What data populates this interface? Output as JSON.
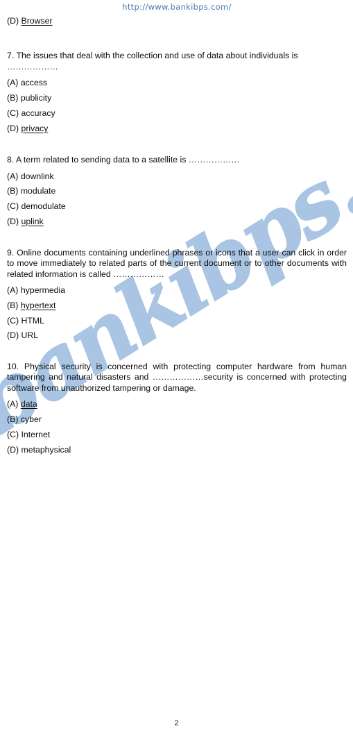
{
  "document": {
    "header_url": "http://www.bankibps.com/",
    "watermark_text": "bankibps.com",
    "page_number": "2",
    "watermark_color": "#a9c5e3",
    "header_color": "#4a7ab0",
    "text_color": "#0d0d0d"
  },
  "carryover_option": {
    "marker": "(D) ",
    "text": "Browser",
    "underlined": true
  },
  "questions": [
    {
      "number": "7",
      "stem": "7. The issues that deal with the collection and use of data about individuals is ………………",
      "justified": false,
      "options": [
        {
          "marker": "(A) ",
          "text": "access",
          "underlined": false
        },
        {
          "marker": "(B) ",
          "text": "publicity",
          "underlined": false
        },
        {
          "marker": "(C) ",
          "text": "accuracy",
          "underlined": false
        },
        {
          "marker": "(D) ",
          "text": "privacy",
          "underlined": true
        }
      ]
    },
    {
      "number": "8",
      "stem": "8. A term related to sending data to a satellite is ………………",
      "justified": false,
      "options": [
        {
          "marker": "(A) ",
          "text": "downlink",
          "underlined": false
        },
        {
          "marker": "(B) ",
          "text": "modulate",
          "underlined": false
        },
        {
          "marker": "(C) ",
          "text": "demodulate",
          "underlined": false
        },
        {
          "marker": "(D) ",
          "text": "uplink",
          "underlined": true
        }
      ]
    },
    {
      "number": "9",
      "stem": "9. Online documents containing underlined phrases or icons that a user can click in order to move immediately to related parts of the current document or to other documents with related information is called ………………",
      "justified": true,
      "options": [
        {
          "marker": "(A) ",
          "text": "hypermedia",
          "underlined": false
        },
        {
          "marker": "(B) ",
          "text": "hypertext",
          "underlined": true
        },
        {
          "marker": "(C) ",
          "text": "HTML",
          "underlined": false
        },
        {
          "marker": "(D) ",
          "text": "URL",
          "underlined": false
        }
      ]
    },
    {
      "number": "10",
      "stem": "10. Physical security is concerned with protecting computer hardware from human tampering and natural disasters and ………………security is concerned with protecting software from unauthorized tampering or damage.",
      "justified": true,
      "options": [
        {
          "marker": "(A) ",
          "text": "data",
          "underlined": true
        },
        {
          "marker": "(B) ",
          "text": "cyber",
          "underlined": false
        },
        {
          "marker": "(C) ",
          "text": "Internet",
          "underlined": false
        },
        {
          "marker": "(D) ",
          "text": "metaphysical",
          "underlined": false
        }
      ]
    }
  ]
}
